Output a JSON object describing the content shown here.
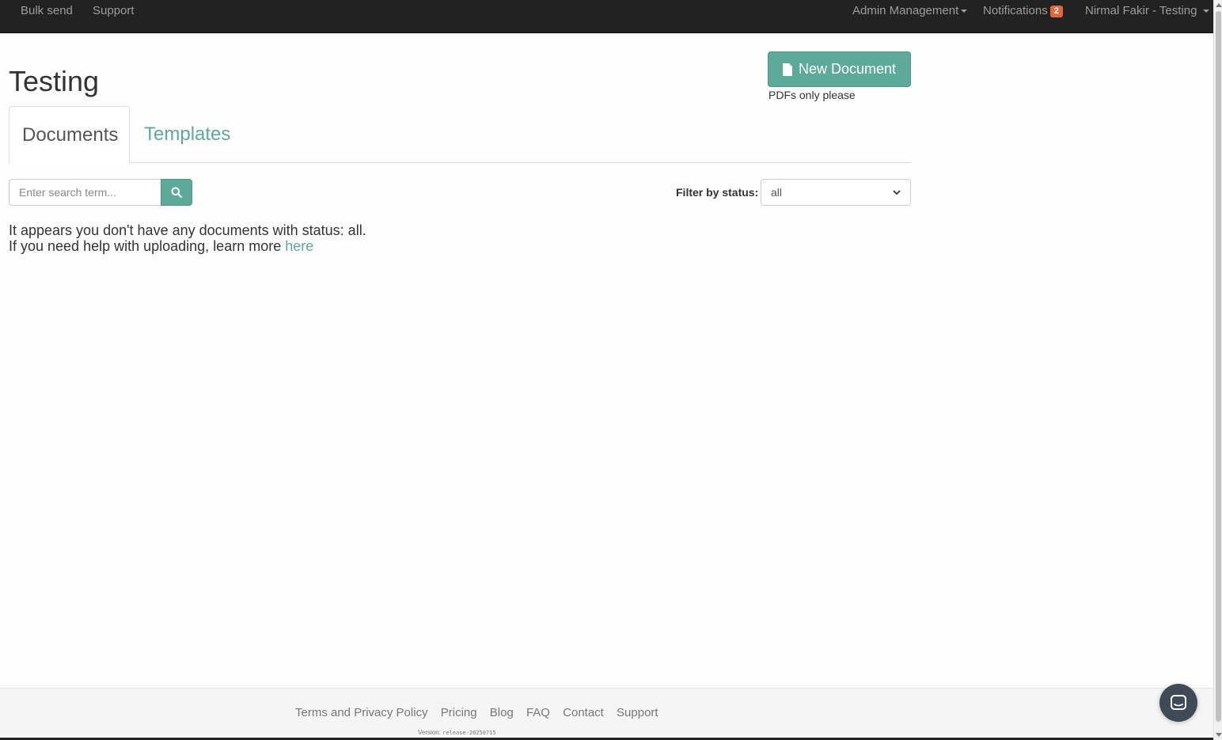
{
  "navbar": {
    "left_items": [
      "Bulk send",
      "Support"
    ],
    "admin_label": "Admin Management",
    "notifications_label": "Notifications",
    "notifications_count": "2",
    "user_label": "Nirmal Fakir - Testing"
  },
  "page": {
    "title": "Testing",
    "new_document_label": "New Document",
    "pdf_note": "PDFs only please"
  },
  "tabs": [
    {
      "label": "Documents",
      "active": true
    },
    {
      "label": "Templates",
      "active": false
    }
  ],
  "search": {
    "placeholder": "Enter search term...",
    "value": ""
  },
  "filter": {
    "label": "Filter by status:",
    "selected": "all"
  },
  "empty_state": {
    "line1": "It appears you don't have any documents with status: all.",
    "line2": "If you need help with uploading, learn more",
    "link": "here"
  },
  "footer": {
    "links": [
      "Terms and Privacy Policy",
      "Pricing",
      "Blog",
      "FAQ",
      "Contact",
      "Support"
    ],
    "version_label": "Version:",
    "version_value": "release-20250715"
  },
  "colors": {
    "accent": "#5da99a",
    "navbar_bg": "#222222",
    "badge": "#e8643c"
  },
  "icons": {
    "new_document": "file-icon",
    "search_button": "search-icon",
    "chat": "chat-icon"
  }
}
